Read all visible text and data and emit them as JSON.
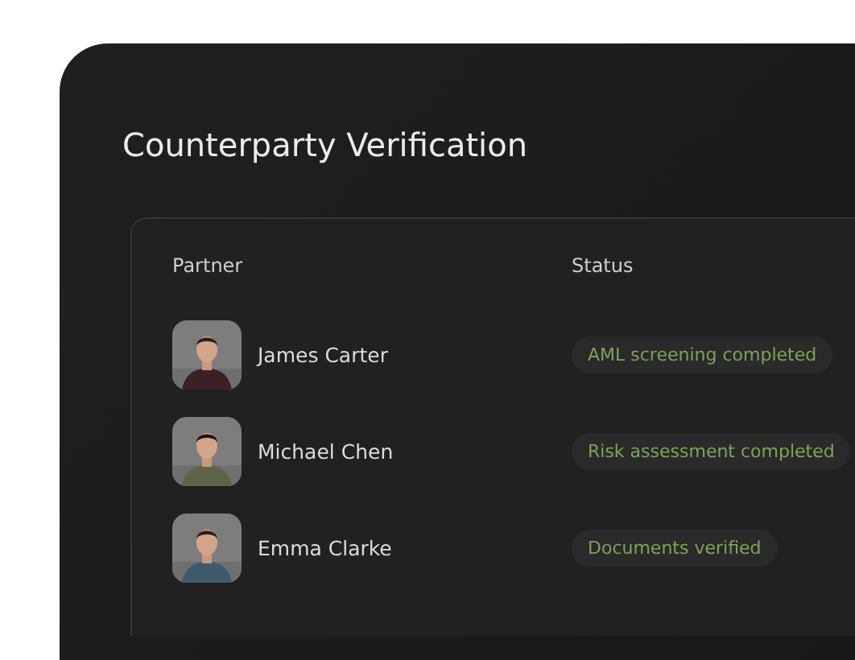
{
  "title": "Counterparty Verification",
  "table": {
    "columns": [
      "Partner",
      "Status"
    ],
    "rows": [
      {
        "partner": "James Carter",
        "status": "AML screening completed"
      },
      {
        "partner": "Michael Chen",
        "status": "Risk assessment completed"
      },
      {
        "partner": "Emma Clarke",
        "status": "Documents verified"
      }
    ]
  }
}
